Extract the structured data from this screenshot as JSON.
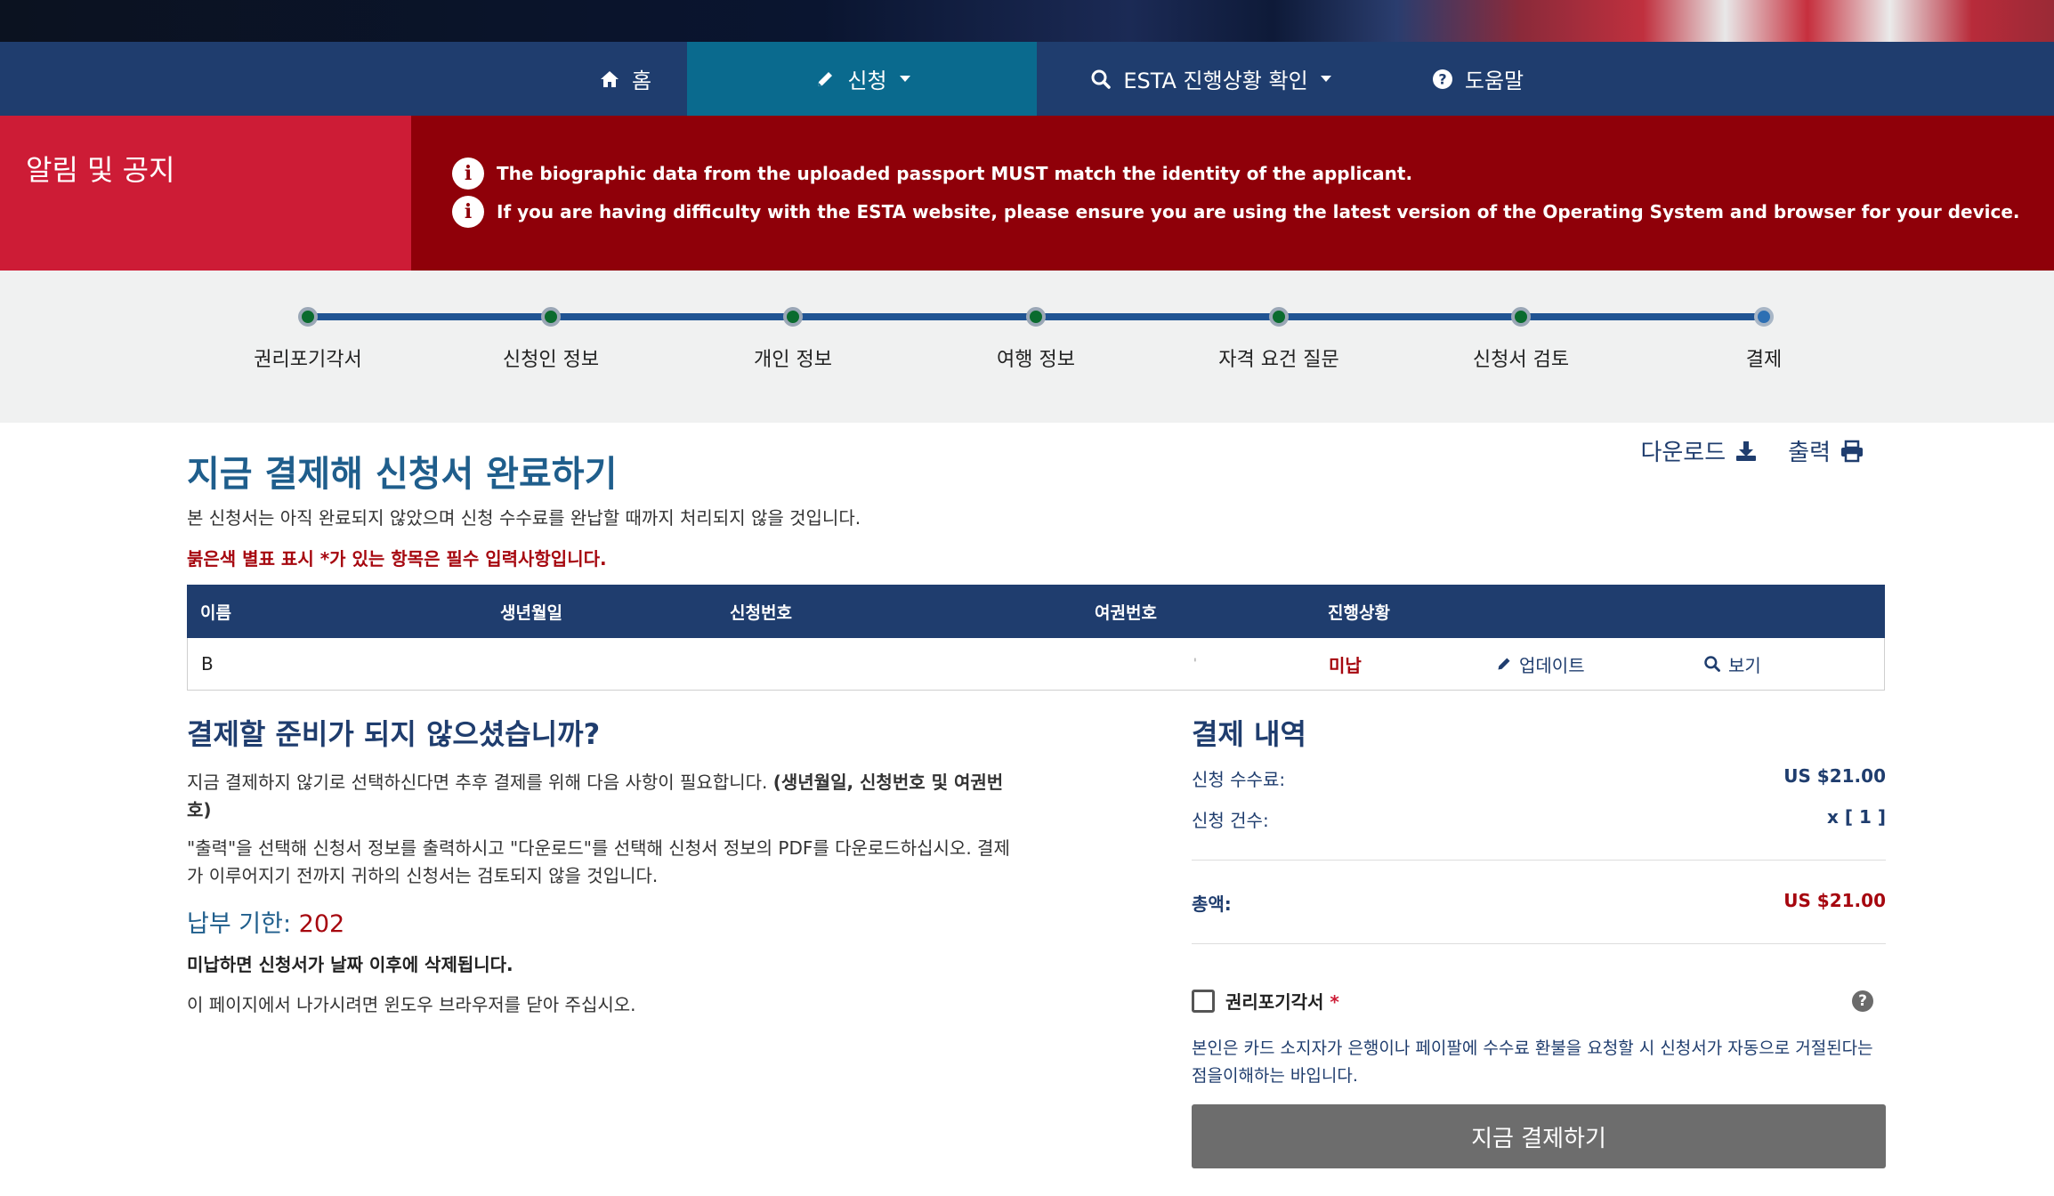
{
  "nav": {
    "home": "홈",
    "apply": "신청",
    "check_status": "ESTA 진행상황 확인",
    "help": "도움말"
  },
  "alert": {
    "title": "알림 및 공지",
    "messages": [
      "The biographic data from the uploaded passport MUST match the identity of the applicant.",
      "If you are having difficulty with the ESTA website, please ensure you are using the latest version of the Operating System and browser for your device."
    ]
  },
  "progress": {
    "steps": [
      "권리포기각서",
      "신청인 정보",
      "개인 정보",
      "여행 정보",
      "자격 요건 질문",
      "신청서 검토",
      "결제"
    ]
  },
  "page": {
    "title": "지금 결제해 신청서 완료하기",
    "download": "다운로드",
    "print": "출력",
    "intro": "본 신청서는 아직 완료되지 않았으며 신청 수수료를 완납할 때까지 처리되지 않을 것입니다.",
    "required_note": "붉은색 별표 표시 *가 있는 항목은 필수 입력사항입니다."
  },
  "table": {
    "headers": [
      "이름",
      "생년월일",
      "신청번호",
      "여권번호",
      "진행상황"
    ],
    "row": {
      "name": "B",
      "dob": "",
      "app_number": "",
      "passport": "'",
      "status": "미납",
      "update": "업데이트",
      "view": "보기"
    }
  },
  "not_ready": {
    "title": "결제할 준비가 되지 않으셨습니까?",
    "para1": "지금 결제하지 않기로 선택하신다면 추후 결제를 위해 다음 사항이 필요합니다.",
    "para1_bold": "(생년월일, 신청번호 및 여권번호)",
    "para2": "\"출력\"을 선택해 신청서 정보를 출력하시고 \"다운로드\"를 선택해 신청서 정보의 PDF를 다운로드하십시오. 결제가 이루어지기 전까지 귀하의 신청서는 검토되지 않을 것입니다.",
    "deadline_label": "납부 기한:",
    "deadline_value": "202",
    "deletion_note": "미납하면 신청서가 날짜 이후에 삭제됩니다.",
    "close_note": "이 페이지에서 나가시려면 윈도우 브라우저를 닫아 주십시오."
  },
  "summary": {
    "title": "결제 내역",
    "fee_label": "신청 수수료:",
    "fee_value": "US $21.00",
    "count_label": "신청 건수:",
    "count_value": "x [ 1 ]",
    "total_label": "총액:",
    "total_value": "US $21.00",
    "waiver_label": "권리포기각서",
    "waiver_required": "*",
    "waiver_text": "본인은 카드 소지자가 은행이나 페이팔에 수수료 환불을 요청할 시 신청서가 자동으로 거절된다는 점을이해하는 바입니다.",
    "pay_button": "지금 결제하기"
  },
  "icons": [
    "home-icon",
    "pencil-icon",
    "search-icon",
    "help-icon",
    "info-icon",
    "download-icon",
    "print-icon"
  ],
  "colors": {
    "nav_bg": "#1f3d6e",
    "nav_active": "#0a6a8e",
    "alert_bg": "#8f0009",
    "alert_left": "#cd1c36",
    "accent_red": "#a6070f",
    "title_blue": "#1f5e8c"
  }
}
